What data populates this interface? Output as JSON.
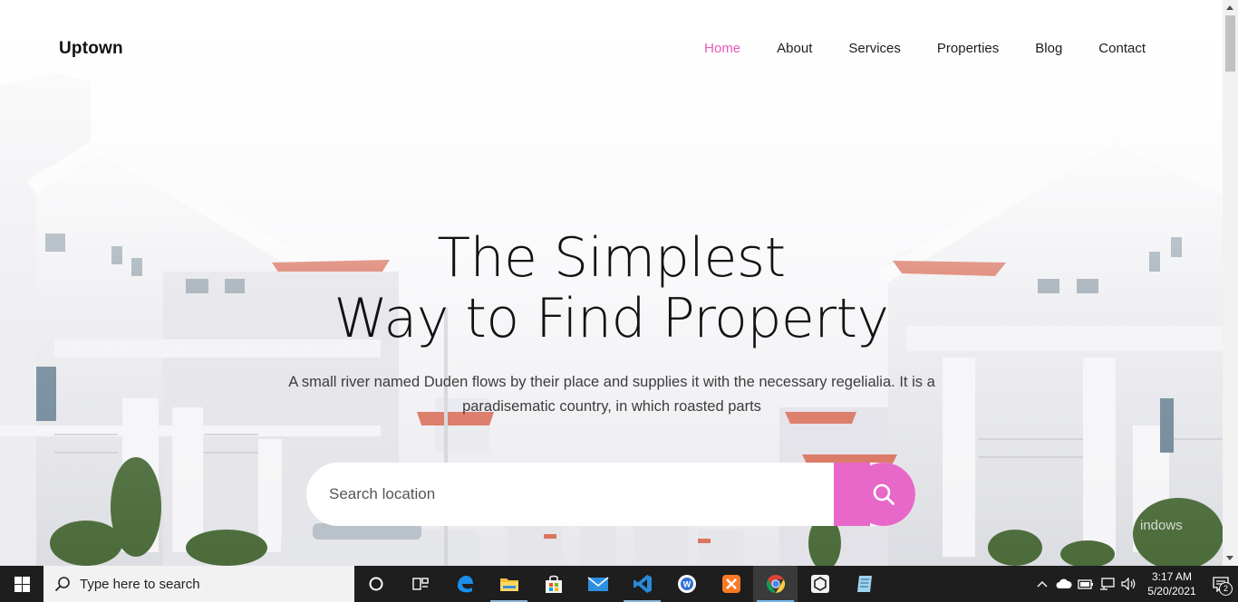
{
  "site": {
    "brand": "Uptown",
    "nav": [
      {
        "label": "Home",
        "active": true
      },
      {
        "label": "About",
        "active": false
      },
      {
        "label": "Services",
        "active": false
      },
      {
        "label": "Properties",
        "active": false
      },
      {
        "label": "Blog",
        "active": false
      },
      {
        "label": "Contact",
        "active": false
      }
    ],
    "accent_color": "#e768c8"
  },
  "hero": {
    "title_line1": "The Simplest",
    "title_line2": "Way to Find Property",
    "subtitle": "A small river named Duden flows by their place and supplies it with the necessary regelialia. It is a paradisematic country, in which roasted parts",
    "search": {
      "placeholder": "Search location",
      "button_icon": "search-icon"
    }
  },
  "watermark": "indows",
  "taskbar": {
    "search_placeholder": "Type here to search",
    "apps": [
      "task-view-icon",
      "edge-icon",
      "file-explorer-icon",
      "store-icon",
      "mail-icon",
      "vscode-icon",
      "wps-writer-icon",
      "xampp-icon",
      "chrome-icon",
      "unity-icon",
      "notes-icon"
    ],
    "clock": {
      "time": "3:17 AM",
      "date": "5/20/2021"
    },
    "notifications": "2"
  }
}
